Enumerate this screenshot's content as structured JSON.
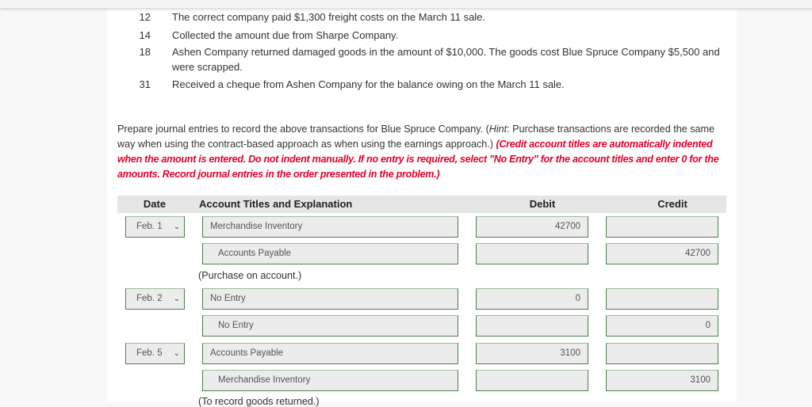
{
  "transactions": [
    {
      "day": "12",
      "text": "The correct company paid $1,300 freight costs on the March 11 sale."
    },
    {
      "day": "14",
      "text": "Collected the amount due from Sharpe Company."
    },
    {
      "day": "18",
      "text": "Ashen Company returned damaged goods in the amount of $10,000. The goods cost Blue Spruce Company $5,500 and were scrapped."
    },
    {
      "day": "31",
      "text": "Received a cheque from Ashen Company for the balance owing on the March 11 sale."
    }
  ],
  "instructions": {
    "part1": "Prepare journal entries to record the above transactions for Blue Spruce Company. (",
    "hint_label": "Hint",
    "part2": ": Purchase transactions are recorded the same way when using the contract-based approach as when using the earnings approach.) ",
    "red_note": "(Credit account titles are automatically indented when the amount is entered. Do not indent manually. If no entry is required, select \"No Entry\" for the account titles and enter 0 for the amounts. Record journal entries in the order presented in the problem.)"
  },
  "table": {
    "headers": {
      "date": "Date",
      "account": "Account Titles and Explanation",
      "debit": "Debit",
      "credit": "Credit"
    },
    "entries": [
      {
        "date": "Feb. 1",
        "lines": [
          {
            "account": "Merchandise Inventory",
            "debit": "42700",
            "credit": ""
          },
          {
            "account": "Accounts Payable",
            "debit": "",
            "credit": "42700"
          }
        ],
        "explanation": "(Purchase on account.)"
      },
      {
        "date": "Feb. 2",
        "lines": [
          {
            "account": "No Entry",
            "debit": "0",
            "credit": ""
          },
          {
            "account": "No Entry",
            "debit": "",
            "credit": "0"
          }
        ],
        "explanation": ""
      },
      {
        "date": "Feb. 5",
        "lines": [
          {
            "account": "Accounts Payable",
            "debit": "3100",
            "credit": ""
          },
          {
            "account": "Merchandise Inventory",
            "debit": "",
            "credit": "3100"
          }
        ],
        "explanation": "(To record goods returned.)"
      }
    ]
  },
  "icons": {
    "select_arrow": "⌄"
  },
  "colors": {
    "correct_border": "#4d7d4d",
    "note_red": "#e4002b",
    "header_bg": "#e6e6e6"
  }
}
